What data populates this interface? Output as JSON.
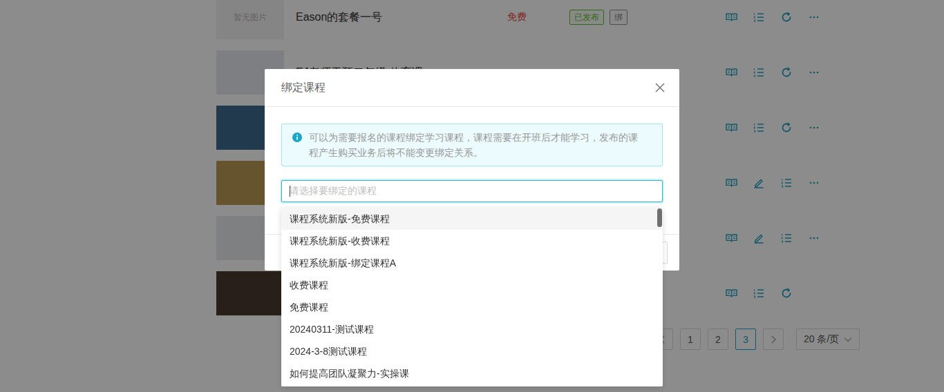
{
  "page": {
    "rows": [
      {
        "thumbnail": {
          "kind": "placeholder",
          "text": "暂无图片"
        },
        "title": "Eason的套餐一号",
        "price": "免费",
        "tags": [
          {
            "label": "已发布",
            "color": "#52c41a"
          },
          {
            "label": "绑",
            "color": "#8c8c8c"
          }
        ],
        "actions": [
          "book",
          "list",
          "refresh",
          "more"
        ]
      },
      {
        "thumbnail": {
          "kind": "photo"
        },
        "title": "EJ老师干预二年级-体育课",
        "price": "",
        "tags": [],
        "actions": [
          "book",
          "list",
          "refresh",
          "more"
        ]
      },
      {
        "thumbnail": {
          "kind": "photo"
        },
        "title": "",
        "price": "",
        "tags": [],
        "actions": [
          "book",
          "list",
          "refresh",
          "more"
        ]
      },
      {
        "thumbnail": {
          "kind": "photo"
        },
        "title": "",
        "price": "",
        "tags": [],
        "actions": [
          "book",
          "edit",
          "list",
          "more"
        ]
      },
      {
        "thumbnail": {
          "kind": "photo"
        },
        "title": "",
        "price": "",
        "tags": [],
        "actions": [
          "book",
          "edit",
          "list",
          "more"
        ]
      },
      {
        "thumbnail": {
          "kind": "photo"
        },
        "title": "",
        "price": "",
        "tags": [],
        "actions": [
          "book",
          "list",
          "refresh"
        ]
      }
    ],
    "pagination": {
      "pages": [
        {
          "label": "1",
          "selected": false
        },
        {
          "label": "2",
          "selected": false
        },
        {
          "label": "3",
          "selected": true
        }
      ],
      "page_size": "20 条/页"
    }
  },
  "modal": {
    "title": "绑定课程",
    "notice": "可以为需要报名的课程绑定学习课程，课程需要在开班后才能学习，发布的课程产生购买业务后将不能变更绑定关系。",
    "select": {
      "placeholder": "请选择要绑定的课程",
      "focused": true
    },
    "options": [
      {
        "label": "课程系统新版-免费课程",
        "active": true
      },
      {
        "label": "课程系统新版-收费课程",
        "active": false
      },
      {
        "label": "课程系统新版-绑定课程A",
        "active": false
      },
      {
        "label": "收费课程",
        "active": false
      },
      {
        "label": "免费课程",
        "active": false
      },
      {
        "label": "20240311-测试课程",
        "active": false
      },
      {
        "label": "2024-3-8测试课程",
        "active": false
      },
      {
        "label": "如何提高团队凝聚力-实操课",
        "active": false
      }
    ]
  }
}
